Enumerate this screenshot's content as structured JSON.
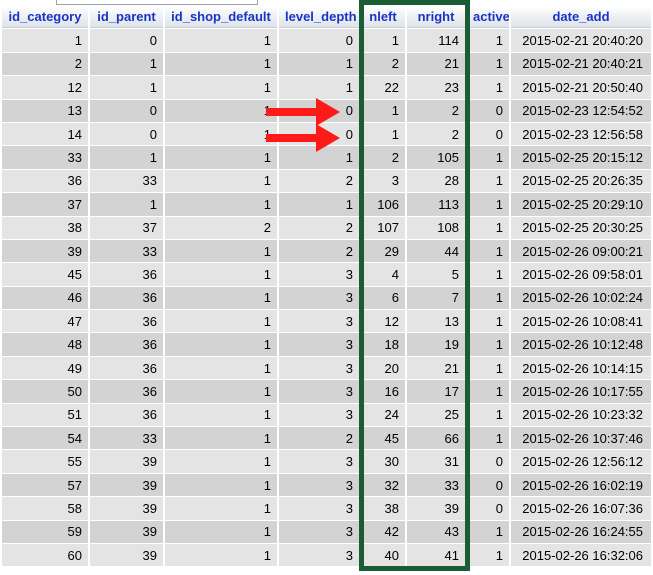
{
  "columns": [
    "id_category",
    "id_parent",
    "id_shop_default",
    "level_depth",
    "nleft",
    "nright",
    "active",
    "date_add"
  ],
  "rows": [
    [
      "1",
      "0",
      "1",
      "0",
      "1",
      "114",
      "1",
      "2015-02-21 20:40:20"
    ],
    [
      "2",
      "1",
      "1",
      "1",
      "2",
      "21",
      "1",
      "2015-02-21 20:40:21"
    ],
    [
      "12",
      "1",
      "1",
      "1",
      "22",
      "23",
      "1",
      "2015-02-21 20:50:40"
    ],
    [
      "13",
      "0",
      "1",
      "0",
      "1",
      "2",
      "0",
      "2015-02-23 12:54:52"
    ],
    [
      "14",
      "0",
      "1",
      "0",
      "1",
      "2",
      "0",
      "2015-02-23 12:56:58"
    ],
    [
      "33",
      "1",
      "1",
      "1",
      "2",
      "105",
      "1",
      "2015-02-25 20:15:12"
    ],
    [
      "36",
      "33",
      "1",
      "2",
      "3",
      "28",
      "1",
      "2015-02-25 20:26:35"
    ],
    [
      "37",
      "1",
      "1",
      "1",
      "106",
      "113",
      "1",
      "2015-02-25 20:29:10"
    ],
    [
      "38",
      "37",
      "2",
      "2",
      "107",
      "108",
      "1",
      "2015-02-25 20:30:25"
    ],
    [
      "39",
      "33",
      "1",
      "2",
      "29",
      "44",
      "1",
      "2015-02-26 09:00:21"
    ],
    [
      "45",
      "36",
      "1",
      "3",
      "4",
      "5",
      "1",
      "2015-02-26 09:58:01"
    ],
    [
      "46",
      "36",
      "1",
      "3",
      "6",
      "7",
      "1",
      "2015-02-26 10:02:24"
    ],
    [
      "47",
      "36",
      "1",
      "3",
      "12",
      "13",
      "1",
      "2015-02-26 10:08:41"
    ],
    [
      "48",
      "36",
      "1",
      "3",
      "18",
      "19",
      "1",
      "2015-02-26 10:12:48"
    ],
    [
      "49",
      "36",
      "1",
      "3",
      "20",
      "21",
      "1",
      "2015-02-26 10:14:15"
    ],
    [
      "50",
      "36",
      "1",
      "3",
      "16",
      "17",
      "1",
      "2015-02-26 10:17:55"
    ],
    [
      "51",
      "36",
      "1",
      "3",
      "24",
      "25",
      "1",
      "2015-02-26 10:23:32"
    ],
    [
      "54",
      "33",
      "1",
      "2",
      "45",
      "66",
      "1",
      "2015-02-26 10:37:46"
    ],
    [
      "55",
      "39",
      "1",
      "3",
      "30",
      "31",
      "0",
      "2015-02-26 12:56:12"
    ],
    [
      "57",
      "39",
      "1",
      "3",
      "32",
      "33",
      "0",
      "2015-02-26 16:02:19"
    ],
    [
      "58",
      "39",
      "1",
      "3",
      "38",
      "39",
      "0",
      "2015-02-26 16:07:36"
    ],
    [
      "59",
      "39",
      "1",
      "3",
      "42",
      "43",
      "1",
      "2015-02-26 16:24:55"
    ],
    [
      "60",
      "39",
      "1",
      "3",
      "40",
      "41",
      "1",
      "2015-02-26 16:32:06"
    ]
  ],
  "colors": {
    "header_text": "#1a33c4",
    "row_light": "#e4e4e4",
    "row_dark": "#d3d3d3",
    "highlight_box": "#1a5c34",
    "arrow": "#ff1a1a"
  },
  "annotation_icons": [
    "arrow-right-icon",
    "arrow-right-icon"
  ]
}
